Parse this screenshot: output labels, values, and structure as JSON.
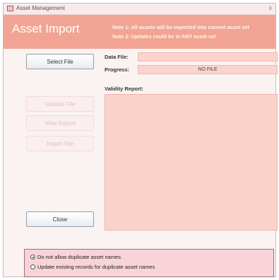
{
  "window": {
    "title": "Asset Management",
    "close_glyph": "x"
  },
  "header": {
    "title": "Asset Import",
    "note1": "Note 1:  All assets will be imported into current asset set",
    "note2": "Note 2:  Updates could be in ANY asset set"
  },
  "buttons": {
    "select_file": "Select File",
    "validate_file": "Validate File",
    "view_report": "View Report",
    "import_file": "Import File",
    "close": "Close"
  },
  "fields": {
    "data_file_label": "Data File:",
    "data_file_value": "",
    "progress_label": "Progress:",
    "progress_value": "NO FILE",
    "validity_report_label": "Validity Report:"
  },
  "options": {
    "duplicate_disallow": "Do not allow duplicate asset names",
    "duplicate_update": "Update existing records for duplicate asset names",
    "selected": "duplicate_disallow"
  },
  "colors": {
    "header_bg": "#f1a494",
    "field_bg": "#fad4cd",
    "options_bg": "#f8d4d8"
  },
  "icons": {
    "app": "database-table-icon",
    "close": "close-icon"
  }
}
